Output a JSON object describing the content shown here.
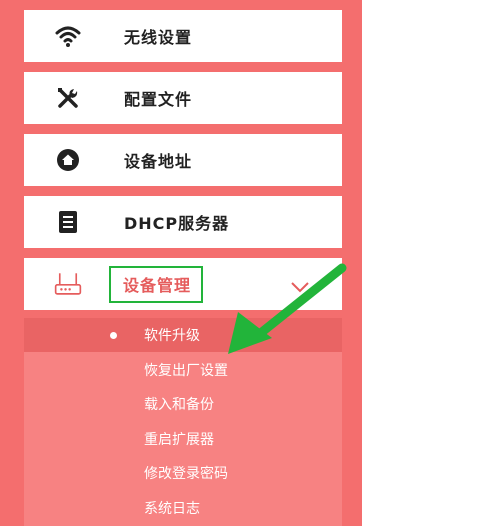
{
  "sidebar": {
    "items": [
      {
        "label": "无线设置",
        "icon": "wifi-icon"
      },
      {
        "label": "配置文件",
        "icon": "tools-icon"
      },
      {
        "label": "设备地址",
        "icon": "home-icon"
      },
      {
        "label": "DHCP服务器",
        "icon": "document-icon"
      },
      {
        "label": "设备管理",
        "icon": "router-icon",
        "expanded": true
      }
    ],
    "submenu": [
      {
        "label": "软件升级",
        "active": true
      },
      {
        "label": "恢复出厂设置"
      },
      {
        "label": "载入和备份"
      },
      {
        "label": "重启扩展器"
      },
      {
        "label": "修改登录密码"
      },
      {
        "label": "系统日志"
      }
    ]
  },
  "colors": {
    "background": "#f46e6e",
    "accent_text": "#e55c5c",
    "highlight_box": "#22b43a",
    "arrow": "#22b43a"
  }
}
